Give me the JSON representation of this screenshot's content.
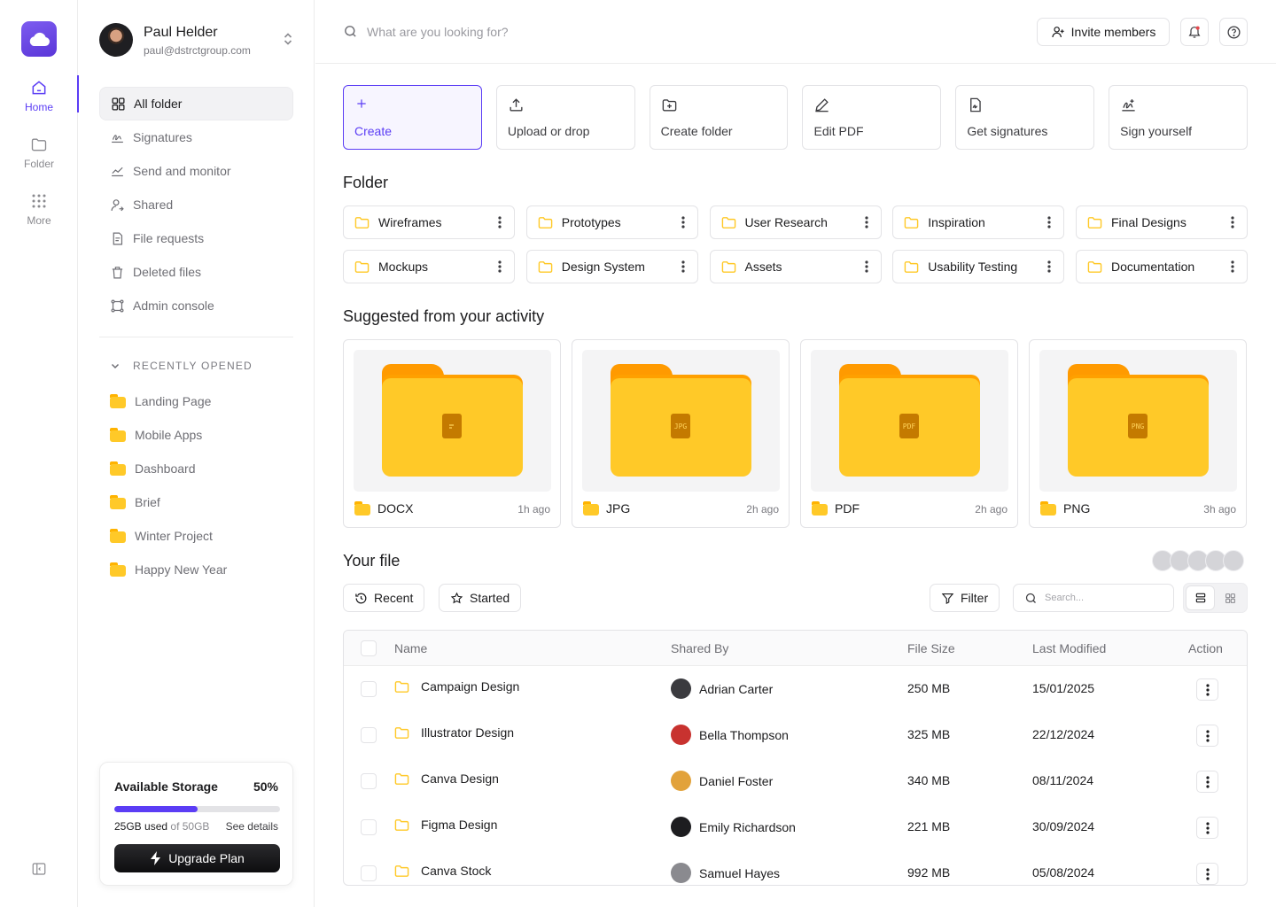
{
  "rail": {
    "home_label": "Home",
    "folder_label": "Folder",
    "more_label": "More"
  },
  "profile": {
    "name": "Paul Helder",
    "email": "paul@dstrctgroup.com"
  },
  "nav": [
    {
      "label": "All folder",
      "icon": "grid-icon",
      "active": true
    },
    {
      "label": "Signatures",
      "icon": "signature-icon"
    },
    {
      "label": "Send and monitor",
      "icon": "chart-line-icon"
    },
    {
      "label": "Shared",
      "icon": "user-share-icon"
    },
    {
      "label": "File requests",
      "icon": "file-request-icon"
    },
    {
      "label": "Deleted files",
      "icon": "trash-icon"
    },
    {
      "label": "Admin console",
      "icon": "admin-frame-icon"
    }
  ],
  "recent": {
    "heading": "RECENTLY OPENED",
    "items": [
      "Landing Page",
      "Mobile Apps",
      "Dashboard",
      "Brief",
      "Winter Project",
      "Happy New Year"
    ]
  },
  "storage": {
    "title": "Available Storage",
    "percent_label": "50%",
    "fill_fraction": 0.5,
    "used": "25GB used",
    "total": "of 50GB",
    "see_details": "See details",
    "upgrade_label": "Upgrade Plan"
  },
  "topbar": {
    "search_placeholder": "What are you looking for?",
    "invite_label": "Invite members"
  },
  "actions": [
    {
      "label": "Create",
      "icon": "plus-icon",
      "primary": true
    },
    {
      "label": "Upload or drop",
      "icon": "upload-icon"
    },
    {
      "label": "Create folder",
      "icon": "folder-plus-icon"
    },
    {
      "label": "Edit PDF",
      "icon": "pen-icon"
    },
    {
      "label": "Get signatures",
      "icon": "file-signature-icon"
    },
    {
      "label": "Sign yourself",
      "icon": "signature-icon"
    }
  ],
  "folder_section": {
    "title": "Folder",
    "folders": [
      "Wireframes",
      "Prototypes",
      "User Research",
      "Inspiration",
      "Final Designs",
      "Mockups",
      "Design System",
      "Assets",
      "Usability Testing",
      "Documentation"
    ]
  },
  "suggested": {
    "title": "Suggested from your activity",
    "cards": [
      {
        "name": "DOCX",
        "time": "1h ago",
        "badge": ""
      },
      {
        "name": "JPG",
        "time": "2h ago",
        "badge": "JPG"
      },
      {
        "name": "PDF",
        "time": "2h ago",
        "badge": "PDF"
      },
      {
        "name": "PNG",
        "time": "3h ago",
        "badge": "PNG"
      }
    ]
  },
  "files": {
    "title": "Your file",
    "recent_label": "Recent",
    "started_label": "Started",
    "filter_label": "Filter",
    "search_placeholder": "Search...",
    "columns": [
      "Name",
      "Shared By",
      "File Size",
      "Last Modified",
      "Action"
    ],
    "rows": [
      {
        "name": "Campaign Design",
        "shared_by": "Adrian Carter",
        "size": "250 MB",
        "modified": "15/01/2025",
        "avatar_color": "#3b3b3f"
      },
      {
        "name": "Illustrator Design",
        "shared_by": "Bella Thompson",
        "size": "325 MB",
        "modified": "22/12/2024",
        "avatar_color": "#c8322f"
      },
      {
        "name": "Canva Design",
        "shared_by": "Daniel Foster",
        "size": "340 MB",
        "modified": "08/11/2024",
        "avatar_color": "#e2a23b"
      },
      {
        "name": "Figma Design",
        "shared_by": "Emily Richardson",
        "size": "221 MB",
        "modified": "30/09/2024",
        "avatar_color": "#1d1d20"
      },
      {
        "name": "Canva Stock",
        "shared_by": "Samuel Hayes",
        "size": "992 MB",
        "modified": "05/08/2024",
        "avatar_color": "#8a8a8f"
      }
    ]
  },
  "colors": {
    "accent": "#5b3df5",
    "folder_yellow": "#ffc928",
    "folder_orange": "#ff9a00"
  }
}
